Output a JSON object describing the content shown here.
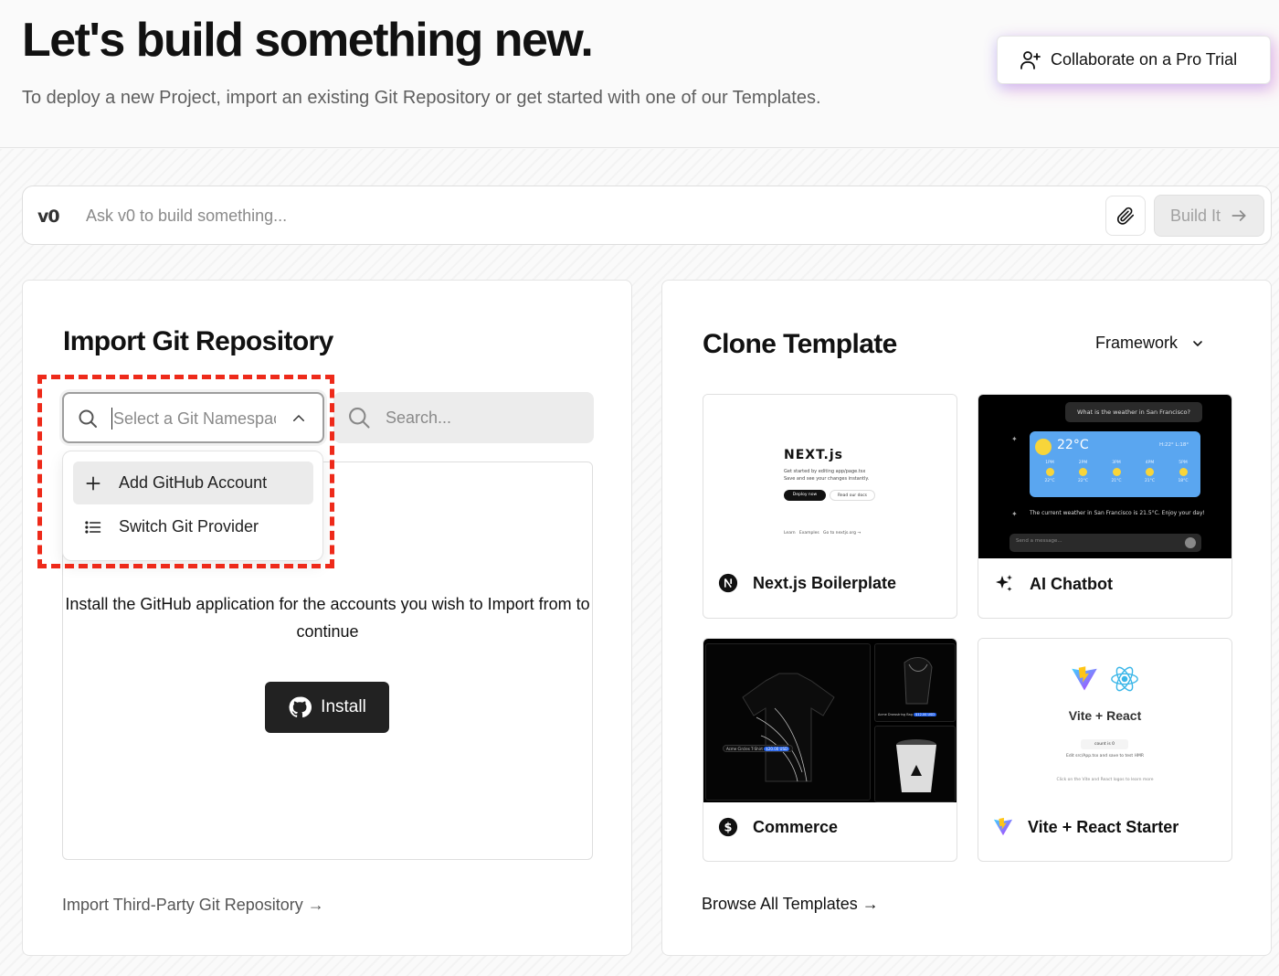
{
  "header": {
    "title": "Let's build something new.",
    "subtitle": "To deploy a new Project, import an existing Git Repository or get started with one of our Templates.",
    "pro_trial_label": "Collaborate on a Pro Trial"
  },
  "v0": {
    "logo": "v0",
    "placeholder": "Ask v0 to build something...",
    "build_label": "Build It"
  },
  "import": {
    "title": "Import Git Repository",
    "namespace_placeholder": "Select a Git Namespace",
    "search_placeholder": "Search...",
    "dropdown": [
      {
        "label": "Add GitHub Account",
        "icon": "plus-icon"
      },
      {
        "label": "Switch Git Provider",
        "icon": "list-icon"
      }
    ],
    "install_text": "Install the GitHub application for the accounts you wish to Import from to continue",
    "install_label": "Install",
    "third_party_link": "Import Third-Party Git Repository →"
  },
  "clone": {
    "title": "Clone Template",
    "framework_label": "Framework",
    "templates": [
      {
        "label": "Next.js Boilerplate",
        "icon": "nextjs-logo-icon"
      },
      {
        "label": "AI Chatbot",
        "icon": "sparkles-icon"
      },
      {
        "label": "Commerce",
        "icon": "dollar-icon"
      },
      {
        "label": "Vite + React Starter",
        "icon": "vite-logo-icon"
      }
    ],
    "browse_link": "Browse All Templates →",
    "thumbs": {
      "next_logo": "NEXT.js",
      "next_line1": "Get started by editing app/page.tsx",
      "next_line2": "Save and see your changes instantly.",
      "next_deploy": "Deploy now",
      "next_docs": "Read our docs",
      "next_footer": "Learn   Examples   Go to nextjs.org →",
      "chat_question": "What is the weather in San Francisco?",
      "chat_temp": "22°C",
      "chat_hilo": "H:22° L:18°",
      "chat_hours": [
        "1PM",
        "2PM",
        "3PM",
        "4PM",
        "5PM"
      ],
      "chat_temps": [
        "22°C",
        "22°C",
        "21°C",
        "21°C",
        "18°C"
      ],
      "chat_answer": "The current weather in San Francisco is 21.5°C. Enjoy your day!",
      "chat_input": "Send a message...",
      "vite_title": "Vite + React",
      "vite_count": "count is 0",
      "vite_edit": "Edit src/App.tsx and save to test HMR",
      "vite_click": "Click on the Vite and React logos to learn more",
      "commerce_tag1": "Acme Circles T-Shirt",
      "commerce_price1": "$20.00 USD",
      "commerce_tag2": "Acme Drawstring Bag",
      "commerce_price2": "$12.00 USD"
    }
  }
}
